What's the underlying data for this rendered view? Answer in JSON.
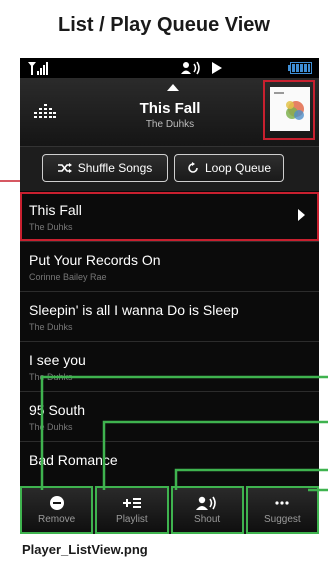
{
  "heading": "List / Play Queue View",
  "caption": "Player_ListView.png",
  "now_playing": {
    "title": "This Fall",
    "artist": "The Duhks"
  },
  "modes": {
    "shuffle_label": "Shuffle Songs",
    "loop_label": "Loop Queue"
  },
  "queue": [
    {
      "title": "This Fall",
      "artist": "The Duhks"
    },
    {
      "title": "Put Your Records On",
      "artist": "Corinne Bailey Rae"
    },
    {
      "title": "Sleepin' is all I wanna Do is Sleep",
      "artist": "The Duhks"
    },
    {
      "title": "I see you",
      "artist": "The Duhks"
    },
    {
      "title": "95 South",
      "artist": "The Duhks"
    },
    {
      "title": "Bad Romance",
      "artist": ""
    }
  ],
  "actions": [
    {
      "label": "Remove",
      "icon": "minus-circle-icon"
    },
    {
      "label": "Playlist",
      "icon": "add-to-playlist-icon"
    },
    {
      "label": "Shout",
      "icon": "shout-icon"
    },
    {
      "label": "Suggest",
      "icon": "more-icon"
    }
  ],
  "colors": {
    "highlight_red": "#c8202f",
    "callout_green": "#3fb34f",
    "battery_blue": "#3f8fd6"
  }
}
